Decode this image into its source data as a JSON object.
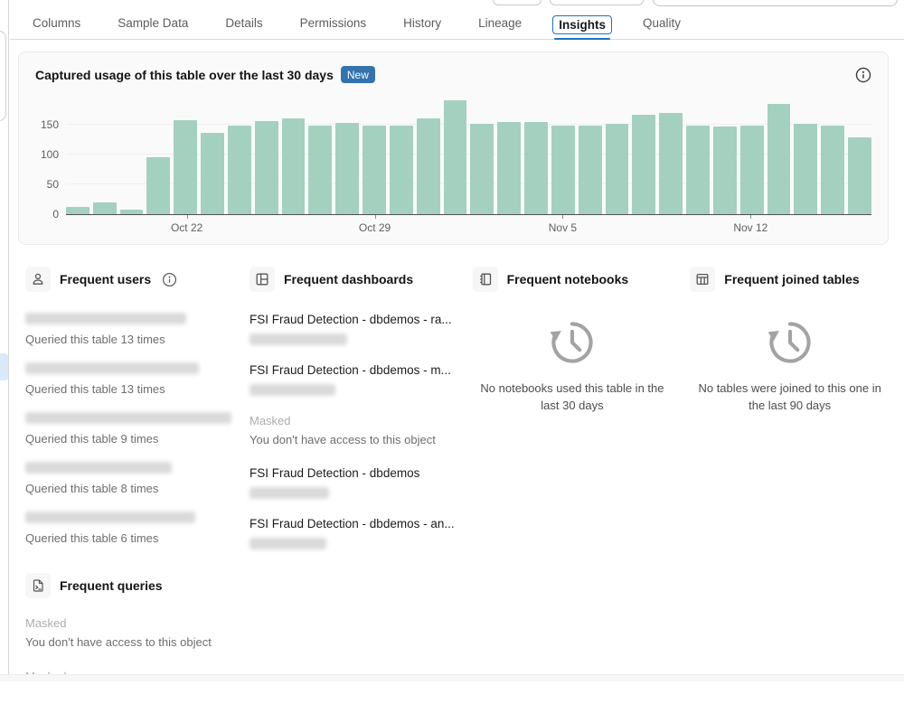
{
  "colors": {
    "accent": "#2272b4",
    "bar": "#a4d0bf",
    "badge_bg": "#3374af"
  },
  "tabs": {
    "items": [
      {
        "label": "Columns",
        "selected": false
      },
      {
        "label": "Sample Data",
        "selected": false
      },
      {
        "label": "Details",
        "selected": false
      },
      {
        "label": "Permissions",
        "selected": false
      },
      {
        "label": "History",
        "selected": false
      },
      {
        "label": "Lineage",
        "selected": false
      },
      {
        "label": "Insights",
        "selected": true
      },
      {
        "label": "Quality",
        "selected": false
      }
    ]
  },
  "usage_panel": {
    "title": "Captured usage of this table over the last 30 days",
    "badge": "New"
  },
  "chart_data": {
    "type": "bar",
    "title": "Captured usage of this table over the last 30 days",
    "values": [
      12,
      19,
      8,
      95,
      157,
      137,
      148,
      156,
      160,
      149,
      153,
      149,
      149,
      160,
      191,
      152,
      154,
      154,
      148,
      148,
      152,
      166,
      170,
      148,
      147,
      148,
      185,
      151,
      149,
      129
    ],
    "x_tick_labels": [
      {
        "label": "Oct 22",
        "index": 4
      },
      {
        "label": "Oct 29",
        "index": 11
      },
      {
        "label": "Nov 5",
        "index": 18
      },
      {
        "label": "Nov 12",
        "index": 25
      }
    ],
    "yticks": [
      0,
      50,
      100,
      150
    ],
    "ylim": [
      0,
      200
    ],
    "bar_color": "#a4d0bf",
    "grid": true,
    "legend": false
  },
  "sections": {
    "users": {
      "title": "Frequent users",
      "items": [
        {
          "masked_name": true,
          "mask_width": 178,
          "description": "Queried this table 13 times"
        },
        {
          "masked_name": true,
          "mask_width": 192,
          "description": "Queried this table 13 times"
        },
        {
          "masked_name": true,
          "mask_width": 228,
          "description": "Queried this table 9 times"
        },
        {
          "masked_name": true,
          "mask_width": 162,
          "description": "Queried this table 8 times"
        },
        {
          "masked_name": true,
          "mask_width": 188,
          "description": "Queried this table 6 times"
        }
      ]
    },
    "dashboards": {
      "title": "Frequent dashboards",
      "items": [
        {
          "type": "link",
          "title": "FSI Fraud Detection - dbdemos - ra...",
          "mask_width": 108
        },
        {
          "type": "link",
          "title": "FSI Fraud Detection - dbdemos - m...",
          "mask_width": 95
        },
        {
          "type": "masked",
          "label": "Masked",
          "text": "You don't have access to this object"
        },
        {
          "type": "link",
          "title": "FSI Fraud Detection - dbdemos",
          "mask_width": 88
        },
        {
          "type": "link",
          "title": "FSI Fraud Detection - dbdemos - an...",
          "mask_width": 85
        }
      ]
    },
    "notebooks": {
      "title": "Frequent notebooks",
      "empty_text": "No notebooks used this table in the last 30 days"
    },
    "joined_tables": {
      "title": "Frequent joined tables",
      "empty_text": "No tables were joined to this one in the last 90 days"
    },
    "queries": {
      "title": "Frequent queries",
      "items": [
        {
          "label": "Masked",
          "text": "You don't have access to this object"
        },
        {
          "label": "Masked",
          "text": ""
        }
      ]
    }
  }
}
